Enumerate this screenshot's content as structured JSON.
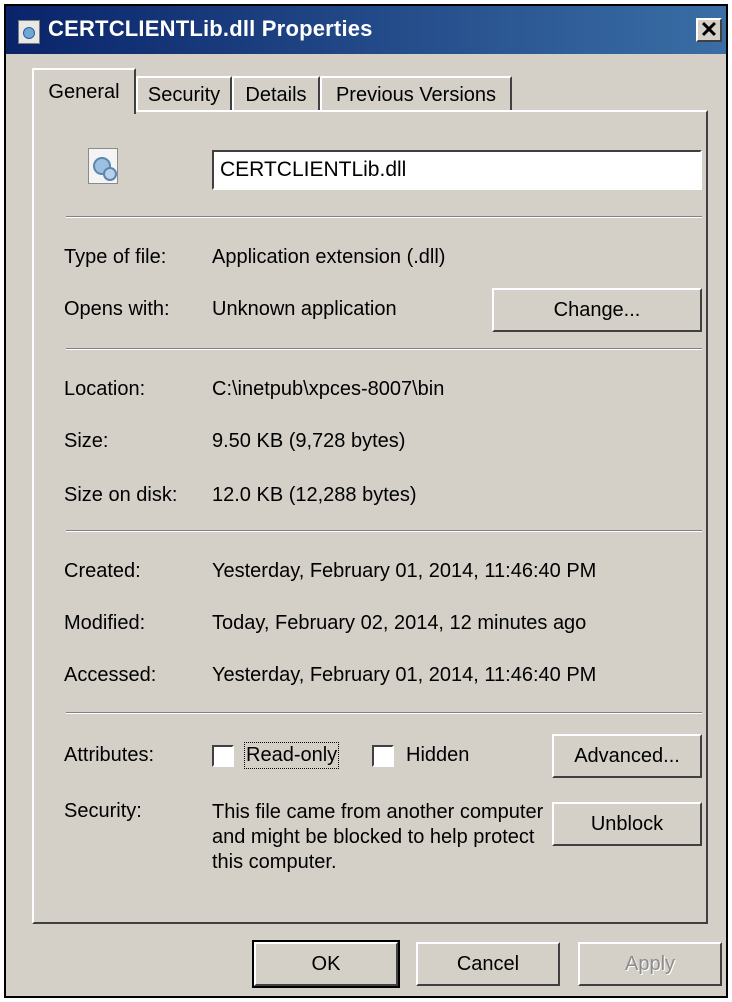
{
  "window": {
    "title": "CERTCLIENTLib.dll Properties",
    "close_label": "✕"
  },
  "tabs": [
    {
      "label": "General",
      "active": true
    },
    {
      "label": "Security",
      "active": false
    },
    {
      "label": "Details",
      "active": false
    },
    {
      "label": "Previous Versions",
      "active": false
    }
  ],
  "general": {
    "filename": "CERTCLIENTLib.dll",
    "type_label": "Type of file:",
    "type_value": "Application extension (.dll)",
    "opens_label": "Opens with:",
    "opens_value": "Unknown application",
    "change_button": "Change...",
    "location_label": "Location:",
    "location_value": "C:\\inetpub\\xpces-8007\\bin",
    "size_label": "Size:",
    "size_value": "9.50 KB (9,728 bytes)",
    "size_on_disk_label": "Size on disk:",
    "size_on_disk_value": "12.0 KB (12,288 bytes)",
    "created_label": "Created:",
    "created_value": "Yesterday, February 01, 2014, 11:46:40 PM",
    "modified_label": "Modified:",
    "modified_value": "Today, February 02, 2014, 12 minutes ago",
    "accessed_label": "Accessed:",
    "accessed_value": "Yesterday, February 01, 2014, 11:46:40 PM",
    "attributes_label": "Attributes:",
    "readonly_label": "Read-only",
    "readonly_checked": false,
    "hidden_label": "Hidden",
    "hidden_checked": false,
    "advanced_button": "Advanced...",
    "security_label": "Security:",
    "security_text": "This file came from another computer and might be blocked to help protect this computer.",
    "unblock_button": "Unblock"
  },
  "footer": {
    "ok_button": "OK",
    "cancel_button": "Cancel",
    "apply_button": "Apply"
  }
}
